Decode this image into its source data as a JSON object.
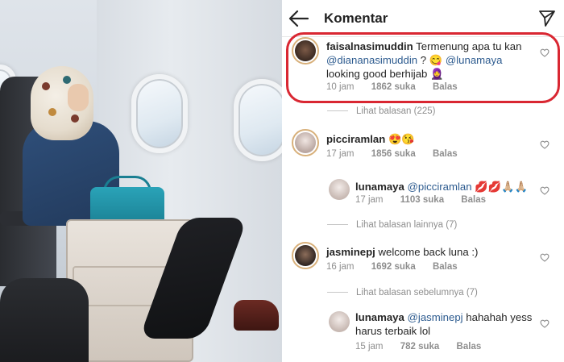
{
  "header": {
    "title": "Komentar",
    "back_icon": "arrow-left-icon",
    "send_icon": "paper-plane-icon"
  },
  "accent": {
    "highlight": "#d92732",
    "mention": "#2d5b8f",
    "meta": "#8e8e8e"
  },
  "comments": [
    {
      "user": "faisalnasimuddin",
      "text_parts": [
        "Termenung apa tu kan",
        "@diananasimuddin",
        " ? 😋 ",
        "@lunamaya",
        " looking good berhijab 🧕"
      ],
      "time": "10 jam",
      "likes": "1862 suka",
      "reply": "Balas",
      "view_replies": "Lihat balasan (225)"
    },
    {
      "user": "picciramlan",
      "text": "😍😘",
      "time": "17 jam",
      "likes": "1856 suka",
      "reply": "Balas"
    },
    {
      "user": "lunamaya",
      "mention": "@picciramlan",
      "text": " 💋💋🙏🏼🙏🏼",
      "time": "17 jam",
      "likes": "1103 suka",
      "reply": "Balas",
      "view_replies": "Lihat balasan lainnya (7)"
    },
    {
      "user": "jasminepj",
      "text": "welcome back luna :)",
      "time": "16 jam",
      "likes": "1692 suka",
      "reply": "Balas",
      "view_replies": "Lihat balasan sebelumnya (7)"
    },
    {
      "user": "lunamaya",
      "mention": "@jasminepj",
      "text": " hahahah yess harus terbaik lol",
      "time": "15 jam",
      "likes": "782 suka",
      "reply": "Balas"
    }
  ]
}
